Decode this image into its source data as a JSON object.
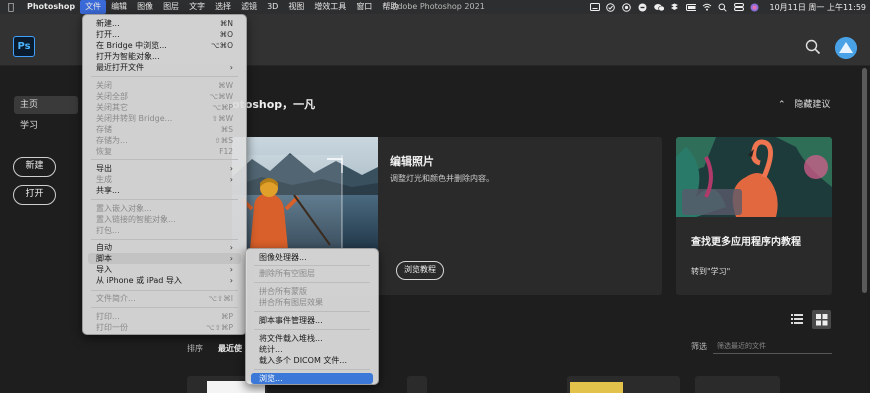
{
  "menubar": {
    "app_name": "Photoshop",
    "items": [
      "文件",
      "编辑",
      "图像",
      "图层",
      "文字",
      "选择",
      "滤镜",
      "3D",
      "视图",
      "增效工具",
      "窗口",
      "帮助"
    ],
    "window_title": "Adobe Photoshop 2021",
    "clock": "10月11日 周一 上午11:59"
  },
  "sidebar": {
    "nav": [
      "主页",
      "学习"
    ],
    "new_label": "新建",
    "open_label": "打开"
  },
  "home": {
    "greeting": "otoshop，一凡",
    "hide_suggestions": "隐藏建议",
    "main_card": {
      "title": "编辑照片",
      "description": "调整灯光和颜色并删除内容。",
      "button": "浏览教程"
    },
    "side_card": {
      "title": "查找更多应用程序内教程",
      "link": "转到\"学习\""
    },
    "sort_label": "排序",
    "sort_value": "最近使",
    "filter_label": "筛选",
    "filter_placeholder": "筛选最近的文件"
  },
  "file_menu": {
    "items": [
      {
        "label": "新建...",
        "shortcut": "⌘N",
        "disabled": false
      },
      {
        "label": "打开...",
        "shortcut": "⌘O",
        "disabled": false
      },
      {
        "label": "在 Bridge 中浏览...",
        "shortcut": "⌥⌘O",
        "disabled": false
      },
      {
        "label": "打开为智能对象...",
        "shortcut": "",
        "disabled": false
      },
      {
        "label": "最近打开文件",
        "shortcut": "",
        "disabled": false,
        "submenu": true
      },
      {
        "label": "关闭",
        "shortcut": "⌘W",
        "disabled": true
      },
      {
        "label": "关闭全部",
        "shortcut": "⌥⌘W",
        "disabled": true
      },
      {
        "label": "关闭其它",
        "shortcut": "⌥⌘P",
        "disabled": true
      },
      {
        "label": "关闭并转到 Bridge...",
        "shortcut": "⇧⌘W",
        "disabled": true
      },
      {
        "label": "存储",
        "shortcut": "⌘S",
        "disabled": true
      },
      {
        "label": "存储为...",
        "shortcut": "⇧⌘S",
        "disabled": true
      },
      {
        "label": "恢复",
        "shortcut": "F12",
        "disabled": true
      },
      {
        "label": "导出",
        "shortcut": "",
        "disabled": false,
        "submenu": true
      },
      {
        "label": "生成",
        "shortcut": "",
        "disabled": true,
        "submenu": true
      },
      {
        "label": "共享...",
        "shortcut": "",
        "disabled": false
      },
      {
        "label": "置入嵌入对象...",
        "shortcut": "",
        "disabled": true
      },
      {
        "label": "置入链接的智能对象...",
        "shortcut": "",
        "disabled": true
      },
      {
        "label": "打包...",
        "shortcut": "",
        "disabled": true
      },
      {
        "label": "自动",
        "shortcut": "",
        "disabled": false,
        "submenu": true
      },
      {
        "label": "脚本",
        "shortcut": "",
        "disabled": false,
        "submenu": true,
        "highlighted": true
      },
      {
        "label": "导入",
        "shortcut": "",
        "disabled": false,
        "submenu": true
      },
      {
        "label": "从 iPhone 或 iPad 导入",
        "shortcut": "",
        "disabled": false,
        "submenu": true
      },
      {
        "label": "文件简介...",
        "shortcut": "⌥⇧⌘I",
        "disabled": true
      },
      {
        "label": "打印...",
        "shortcut": "⌘P",
        "disabled": true
      },
      {
        "label": "打印一份",
        "shortcut": "⌥⇧⌘P",
        "disabled": true
      }
    ]
  },
  "script_menu": {
    "items": [
      {
        "label": "图像处理器...",
        "disabled": false
      },
      {
        "label": "删除所有空图层",
        "disabled": true
      },
      {
        "label": "拼合所有蒙版",
        "disabled": true
      },
      {
        "label": "拼合所有图层效果",
        "disabled": true
      },
      {
        "label": "脚本事件管理器...",
        "disabled": false
      },
      {
        "label": "将文件载入堆栈...",
        "disabled": false
      },
      {
        "label": "统计...",
        "disabled": false
      },
      {
        "label": "载入多个 DICOM 文件...",
        "disabled": false
      },
      {
        "label": "浏览...",
        "disabled": false,
        "selected": true
      }
    ]
  }
}
